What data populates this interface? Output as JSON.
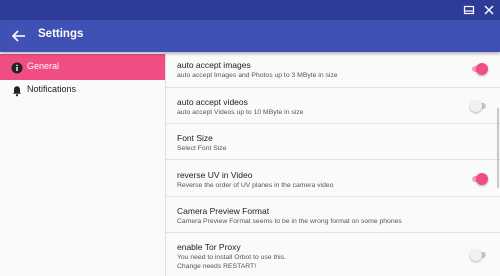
{
  "app": {
    "title": "Settings"
  },
  "colors": {
    "titlebar": "#2e3b97",
    "appbar": "#3f51b5",
    "accent": "#ef4d84"
  },
  "sidebar": {
    "items": [
      {
        "label": "General",
        "icon": "info-icon",
        "active": true
      },
      {
        "label": "Notifications",
        "icon": "bell-icon",
        "active": false
      }
    ]
  },
  "settings": [
    {
      "title": "auto accept images",
      "summary": [
        "auto accept Images and Photos up to 3 MByte in size"
      ],
      "toggle": true
    },
    {
      "title": "auto accept videos",
      "summary": [
        "auto accept Videos up to 10 MByte in size"
      ],
      "toggle": false
    },
    {
      "title": "Font Size",
      "summary": [
        "Select Font Size"
      ]
    },
    {
      "title": "reverse UV in Video",
      "summary": [
        "Reverse the order of UV planes in the camera video"
      ],
      "toggle": true
    },
    {
      "title": "Camera Preview Format",
      "summary": [
        "Camera Preview Format seems to be in the wrong format on some phones"
      ]
    },
    {
      "title": "enable Tor Proxy",
      "summary": [
        "You need to install Orbot to use this.",
        "Change needs RESTART!"
      ],
      "toggle": false
    }
  ]
}
